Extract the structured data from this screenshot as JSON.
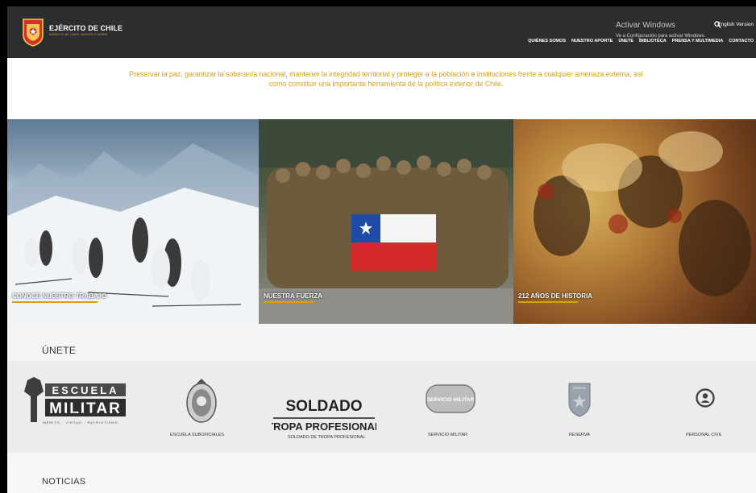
{
  "header": {
    "brand_name": "EJÉRCITO DE CHILE",
    "brand_tagline": "EJÉRCITO DE CHILE, VENCER O MORIR",
    "search_icon": "search-icon",
    "english_label": "English Version",
    "nav": [
      {
        "label": "QUIÉNES SOMOS"
      },
      {
        "label": "NUESTRO APORTE"
      },
      {
        "label": "ÚNETE"
      },
      {
        "label": "BIBLIOTECA"
      },
      {
        "label": "PRENSA Y MULTIMEDIA"
      },
      {
        "label": "CONTACTO"
      }
    ]
  },
  "mission": {
    "text": "Preservar la paz, garantizar la soberanía nacional, mantener la integridad territorial y proteger a la población e instituciones frente a cualquier amenaza externa, así como constituir una importante herramienta de la política exterior de Chile."
  },
  "hero": [
    {
      "label": "CONOCE NUESTRO TRABAJO"
    },
    {
      "label": "NUESTRA FUERZA"
    },
    {
      "label": "212 AÑOS DE HISTORIA"
    }
  ],
  "unete": {
    "title": "ÚNETE",
    "items": [
      {
        "caption": "ESCUELA MILITAR",
        "logo_line1": "ESCUELA",
        "logo_line2": "MILITAR",
        "logo_sub": "MÉRITO · VIRTUD · PATRIOTISMO"
      },
      {
        "caption": "ESCUELA SUBOFICIALES"
      },
      {
        "caption": "SOLDADO DE TROPA PROFESIONAL",
        "logo_line1": "SOLDADO",
        "logo_line2": "TROPA PROFESIONAL"
      },
      {
        "caption": "SERVICIO MILITAR",
        "logo_text": "SERVICIO MILITAR"
      },
      {
        "caption": "RESERVA",
        "logo_text": "RESERVA"
      },
      {
        "caption": "PERSONAL CIVIL",
        "icon": "person-icon"
      }
    ]
  },
  "noticias": {
    "title": "NOTICIAS"
  },
  "windows_notice": {
    "title": "Activar Windows",
    "subtitle": "Ve a Configuración para activar Windows."
  },
  "colors": {
    "header_bg": "#2c2d2e",
    "accent_gold": "#d4a017",
    "logo_red": "#d32f2f"
  }
}
